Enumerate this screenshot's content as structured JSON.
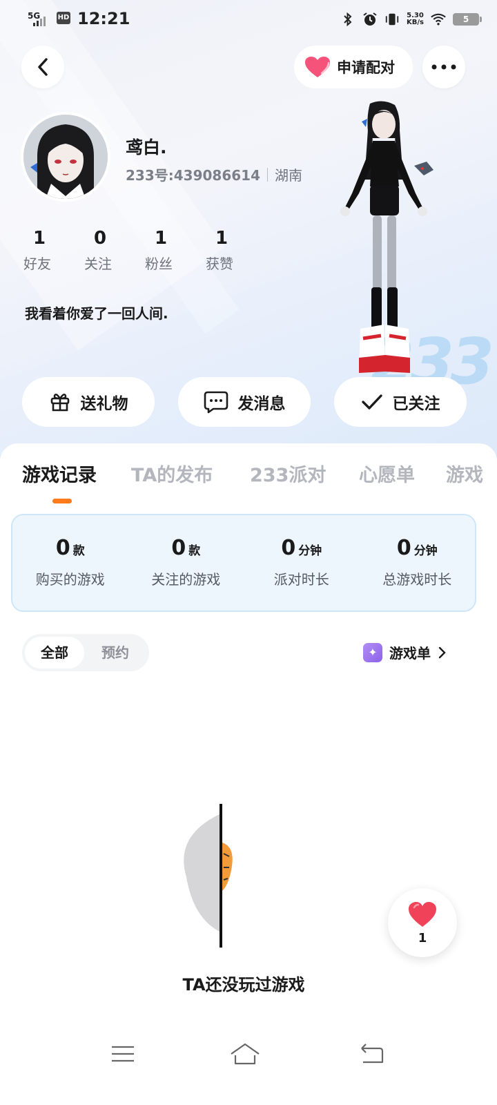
{
  "status_bar": {
    "network": "5G",
    "hd": "HD",
    "time": "12:21",
    "speed_value": "5.30",
    "speed_unit": "KB/s",
    "battery": "5"
  },
  "header": {
    "pair_label": "申请配对"
  },
  "profile": {
    "name": "鸢白.",
    "id_text": "233号:439086614",
    "region": "湖南",
    "bio": "我看着你爱了一回人间.",
    "stats": [
      {
        "num": "1",
        "label": "好友"
      },
      {
        "num": "0",
        "label": "关注"
      },
      {
        "num": "1",
        "label": "粉丝"
      },
      {
        "num": "1",
        "label": "获赞"
      }
    ],
    "watermark": "233"
  },
  "actions": {
    "gift": "送礼物",
    "message": "发消息",
    "follow": "已关注"
  },
  "tabs": [
    "游戏记录",
    "TA的发布",
    "233派对",
    "心愿单",
    "游戏"
  ],
  "active_tab": 0,
  "summary": [
    {
      "value": "0",
      "unit": "款",
      "label": "购买的游戏"
    },
    {
      "value": "0",
      "unit": "款",
      "label": "关注的游戏"
    },
    {
      "value": "0",
      "unit": "分钟",
      "label": "派对时长"
    },
    {
      "value": "0",
      "unit": "分钟",
      "label": "总游戏时长"
    }
  ],
  "filter": {
    "all": "全部",
    "reserve": "预约"
  },
  "game_list_label": "游戏单",
  "empty_text": "TA还没玩过游戏",
  "like_count": "1",
  "colors": {
    "accent_orange": "#ff7a1a",
    "heart": "#f0435a",
    "summary_bg": "#eef6fd"
  }
}
